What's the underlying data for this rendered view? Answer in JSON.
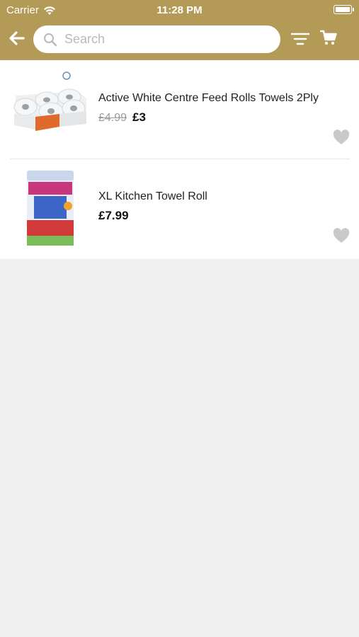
{
  "status_bar": {
    "carrier": "Carrier",
    "time": "11:28 PM"
  },
  "header": {
    "background": "#b39a57",
    "back_icon": "back-arrow-icon",
    "search": {
      "placeholder": "Search",
      "value": ""
    },
    "filter_icon": "filter-icon",
    "cart_icon": "cart-icon"
  },
  "products": [
    {
      "title": "Active White Centre Feed Rolls Towels 2Ply",
      "old_price": "£4.99",
      "price": "£3",
      "image": "paper-towel-rolls-pack",
      "favorite_icon": "heart-icon"
    },
    {
      "title": "XL Kitchen Towel Roll",
      "old_price": "",
      "price": "£7.99",
      "image": "kitchen-towel-roll",
      "favorite_icon": "heart-icon"
    }
  ]
}
